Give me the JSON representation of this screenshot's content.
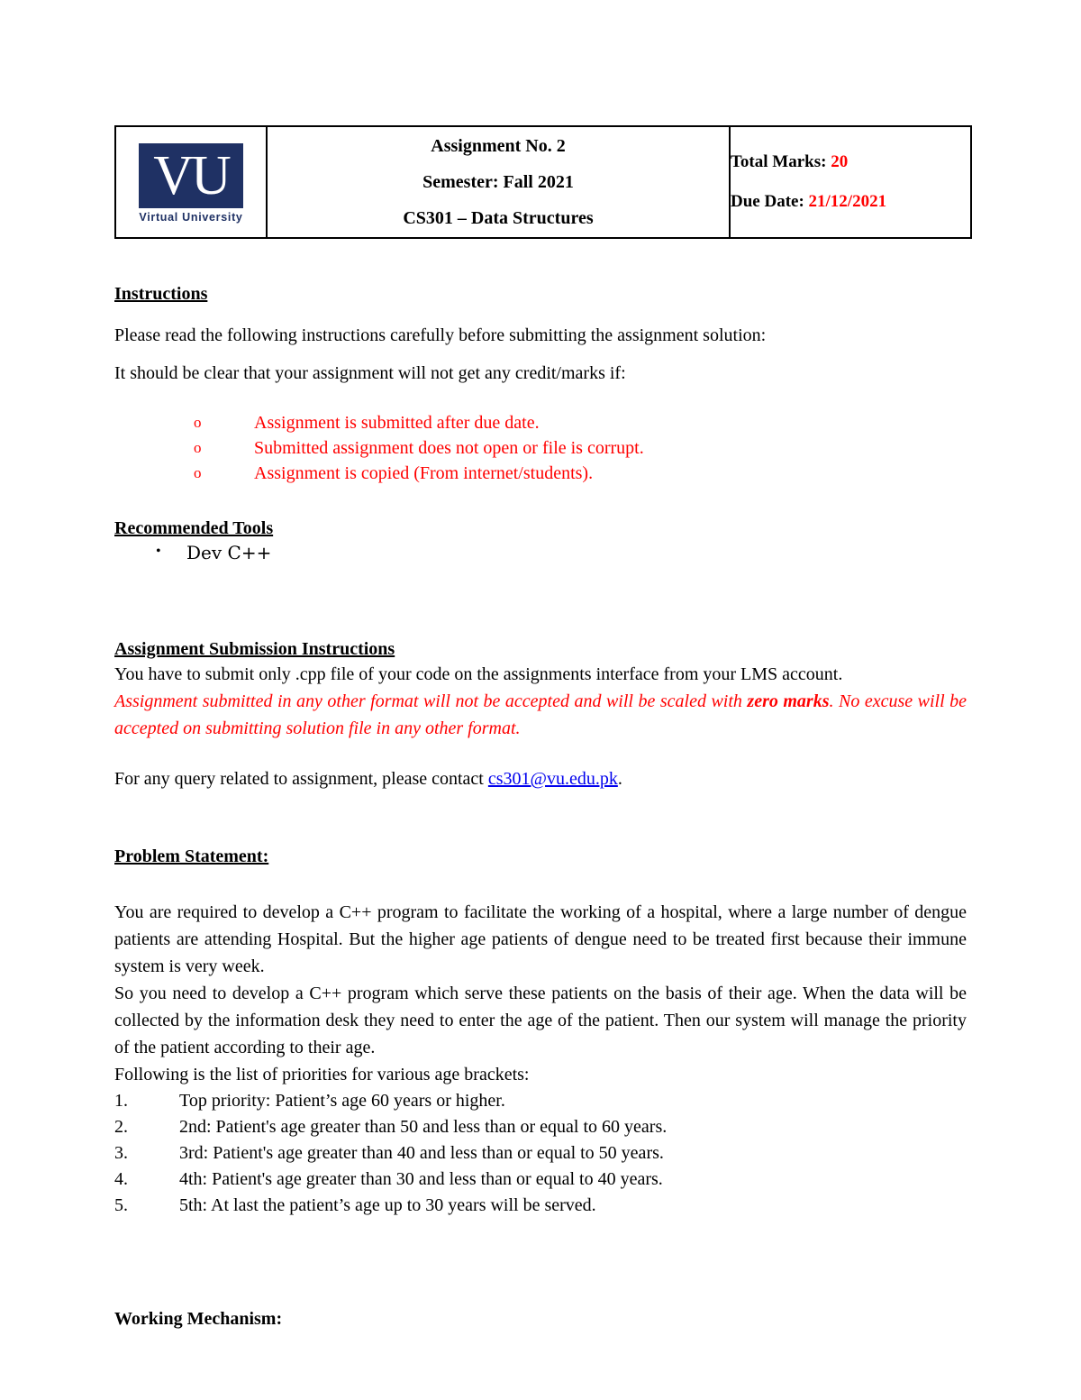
{
  "document": {
    "type": "assignment-handout"
  },
  "header": {
    "logo": {
      "mark": "VU",
      "caption": "Virtual University",
      "color": "#1f3164"
    },
    "title_lines": [
      "Assignment No.  2",
      "Semester: Fall 2021",
      "CS301 – Data Structures"
    ],
    "meta": [
      {
        "label": "Total Marks:",
        "value": "20"
      },
      {
        "label": "Due Date:",
        "value": "21/12/2021"
      }
    ],
    "accent_color": "#ff0000"
  },
  "instructions": {
    "heading": "Instructions",
    "intro_1": "Please read the following instructions carefully before submitting the assignment solution:",
    "intro_2": "It should be clear that your assignment will not get any credit/marks if:",
    "bullet_marker": "o",
    "items": [
      "Assignment is submitted after due date.",
      "Submitted assignment does not open or file is corrupt.",
      "Assignment is copied (From internet/students)."
    ]
  },
  "tools": {
    "heading": "Recommended Tools",
    "bullet_marker": "•",
    "items": [
      "Dev C++"
    ]
  },
  "submission": {
    "heading": "Assignment Submission Instructions ",
    "paragraph": "You have to submit only .cpp file of your code on the assignments interface from your LMS account.",
    "warning_bold": "zero marks",
    "warning_before": "Assignment submitted in any other format will not be accepted and will be scaled with ",
    "warning_after": ". No excuse will be accepted on submitting solution file in any other format.",
    "query_before": "For any query related to assignment, please contact ",
    "query_email": "cs301@vu.edu.pk",
    "query_after": "."
  },
  "problem": {
    "heading": "Problem Statement:",
    "paragraphs": [
      "You are required to develop a C++ program to facilitate the working of a hospital, where a large number of dengue patients are attending Hospital. But the higher age patients of dengue need to be treated first because their immune system is very week.",
      "So you need to develop a C++ program which serve these patients on the basis of their age. When the data will be collected by the information desk they need to enter the age of the patient. Then our system will manage the priority of the patient according to their age.",
      "Following is the list of priorities for various age brackets:"
    ],
    "priorities": [
      {
        "num": "1.",
        "text": "Top priority: Patient’s age 60 years or higher."
      },
      {
        "num": "2.",
        "text": "2nd: Patient's age greater than 50 and less than or equal to 60 years."
      },
      {
        "num": "3.",
        "text": "3rd: Patient's age greater than 40 and less than or equal to 50 years."
      },
      {
        "num": "4.",
        "text": "4th: Patient's age greater than 30 and less than or equal to 40 years."
      },
      {
        "num": "5.",
        "text": "5th: At last the patient’s age up to 30 years will be served."
      }
    ]
  },
  "working": {
    "heading": "Working Mechanism:"
  }
}
